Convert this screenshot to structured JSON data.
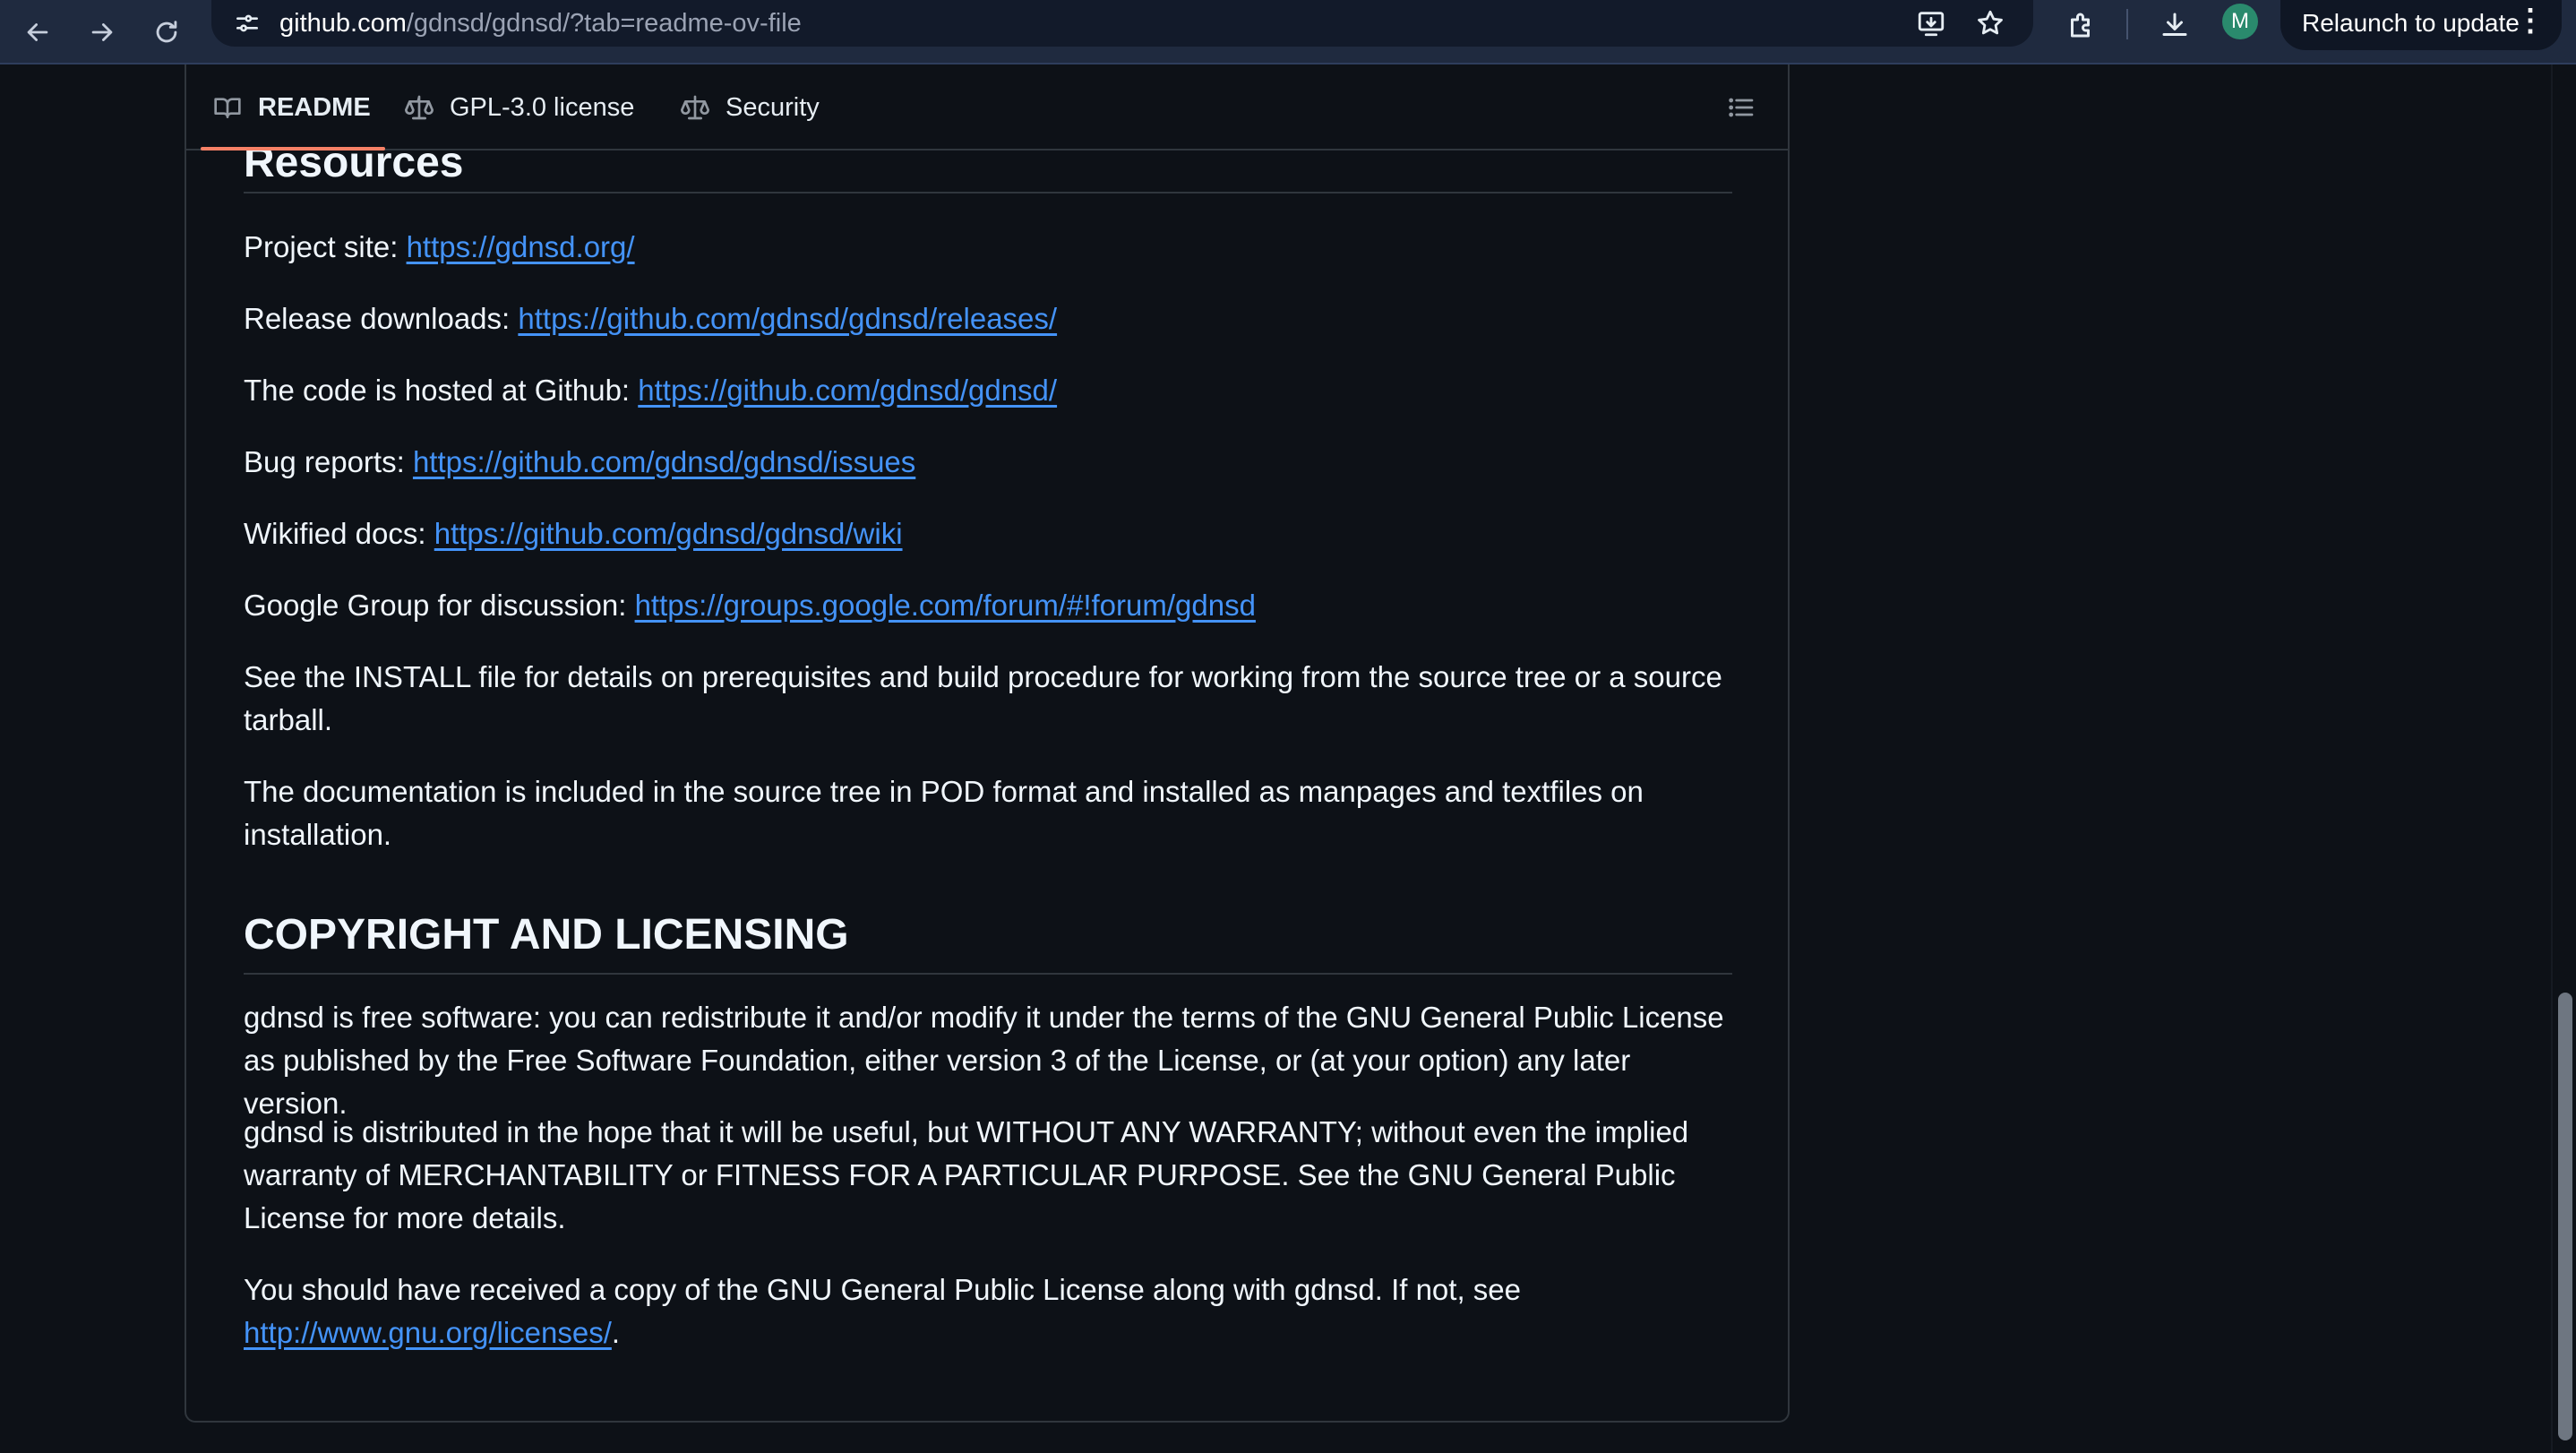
{
  "browser": {
    "url_host": "github.com",
    "url_path": "/gdnsd/gdnsd/?tab=readme-ov-file",
    "profile_initial": "M",
    "relaunch_label": "Relaunch to update",
    "menu_glyph": "⋮",
    "icons": [
      "back-arrow-icon",
      "forward-arrow-icon",
      "reload-icon",
      "site-info-icon",
      "install-app-icon",
      "bookmark-star-icon",
      "extensions-icon",
      "downloads-icon",
      "kebab-menu-icon"
    ]
  },
  "readme_nav": {
    "tabs": [
      {
        "label": "README",
        "icon": "book-icon",
        "active": true
      },
      {
        "label": "GPL-3.0 license",
        "icon": "law-scale-icon",
        "active": false
      },
      {
        "label": "Security",
        "icon": "law-scale-icon",
        "active": false
      }
    ],
    "outline_icon": "list-outline-icon",
    "active_underline_color": "#f78166"
  },
  "article": {
    "resources_heading": "Resources",
    "project_site": {
      "label": "Project site: ",
      "link": "https://gdnsd.org/"
    },
    "release_downloads": {
      "label": "Release downloads: ",
      "link": "https://github.com/gdnsd/gdnsd/releases/"
    },
    "code_hosted": {
      "label": "The code is hosted at Github: ",
      "link": "https://github.com/gdnsd/gdnsd/"
    },
    "bug_reports": {
      "label": "Bug reports: ",
      "link": "https://github.com/gdnsd/gdnsd/issues"
    },
    "wiki_docs": {
      "label": "Wikified docs: ",
      "link": "https://github.com/gdnsd/gdnsd/wiki"
    },
    "google_group": {
      "label": "Google Group for discussion: ",
      "link": "https://groups.google.com/forum/#!forum/gdnsd"
    },
    "install_note": "See the INSTALL file for details on prerequisites and build procedure for working from the source tree or a source tarball.",
    "docs_note": "The documentation is included in the source tree in POD format and installed as manpages and textfiles on installation.",
    "copyright_heading": "COPYRIGHT AND LICENSING",
    "license_p1": "gdnsd is free software: you can redistribute it and/or modify it under the terms of the GNU General Public License as published by the Free Software Foundation, either version 3 of the License, or (at your option) any later version.",
    "license_p2": "gdnsd is distributed in the hope that it will be useful, but WITHOUT ANY WARRANTY; without even the implied warranty of MERCHANTABILITY or FITNESS FOR A PARTICULAR PURPOSE. See the GNU General Public License for more details.",
    "license_p3": {
      "text": "You should have received a copy of the GNU General Public License along with gdnsd. If not, see ",
      "link": "http://www.gnu.org/licenses/",
      "end": "."
    }
  },
  "colors": {
    "page_bg": "#0d1117",
    "link": "#4493f8",
    "text": "#f0f6fc",
    "border": "#30363d",
    "chrome_bg": "#1f2a3f",
    "avatar_bg": "#2a8a6d"
  }
}
